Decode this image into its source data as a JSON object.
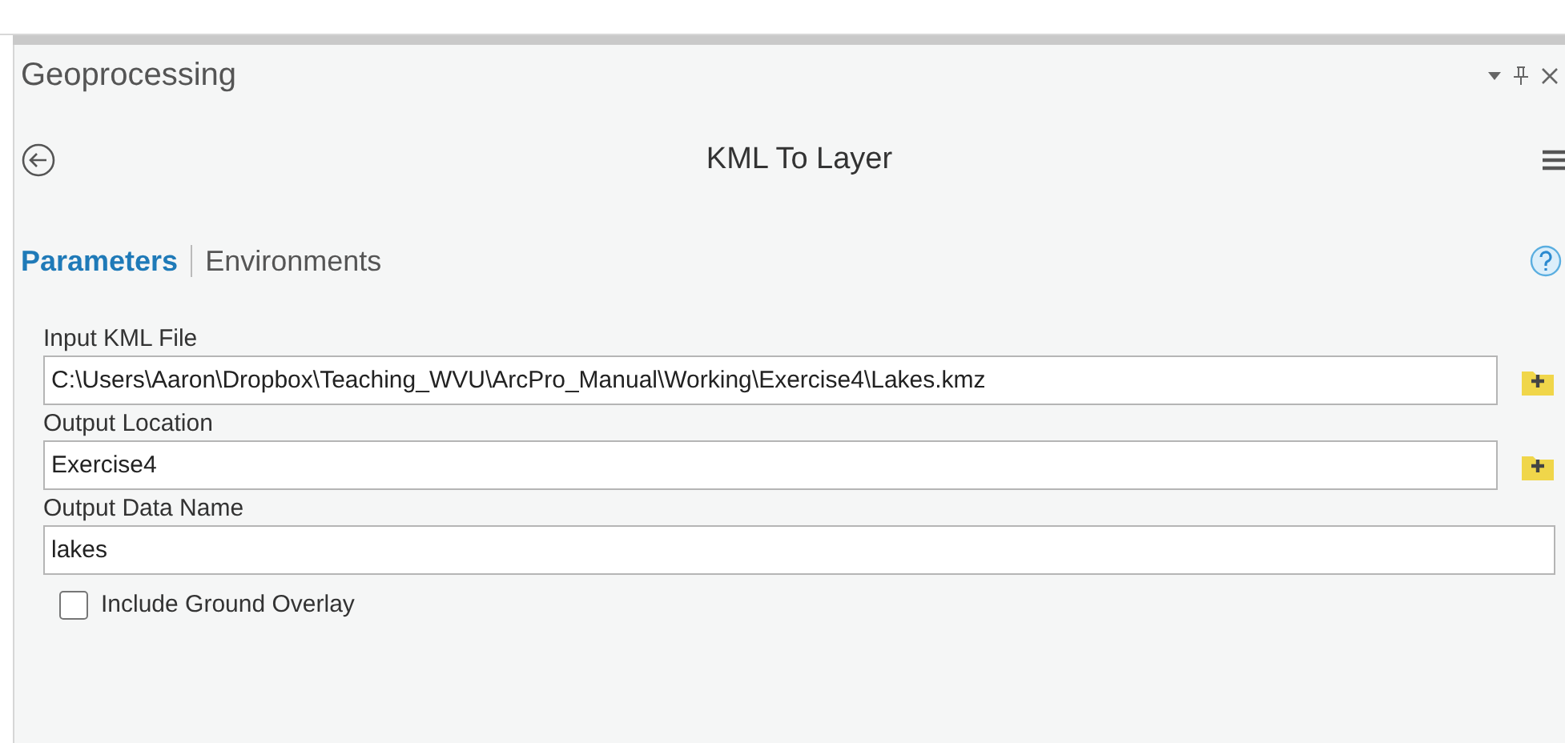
{
  "pane": {
    "title": "Geoprocessing"
  },
  "tool": {
    "title": "KML To Layer"
  },
  "tabs": [
    {
      "label": "Parameters",
      "selected": true
    },
    {
      "label": "Environments",
      "selected": false
    }
  ],
  "parameters": [
    {
      "kind": "file",
      "label": "Input KML File",
      "value": "C:\\Users\\Aaron\\Dropbox\\Teaching_WVU\\ArcPro_Manual\\Working\\Exercise4\\Lakes.kmz"
    },
    {
      "kind": "file",
      "label": "Output Location",
      "value": "Exercise4"
    },
    {
      "kind": "text",
      "label": "Output Data Name",
      "value": "lakes"
    }
  ],
  "options": [
    {
      "label": "Include Ground Overlay",
      "checked": false
    }
  ]
}
